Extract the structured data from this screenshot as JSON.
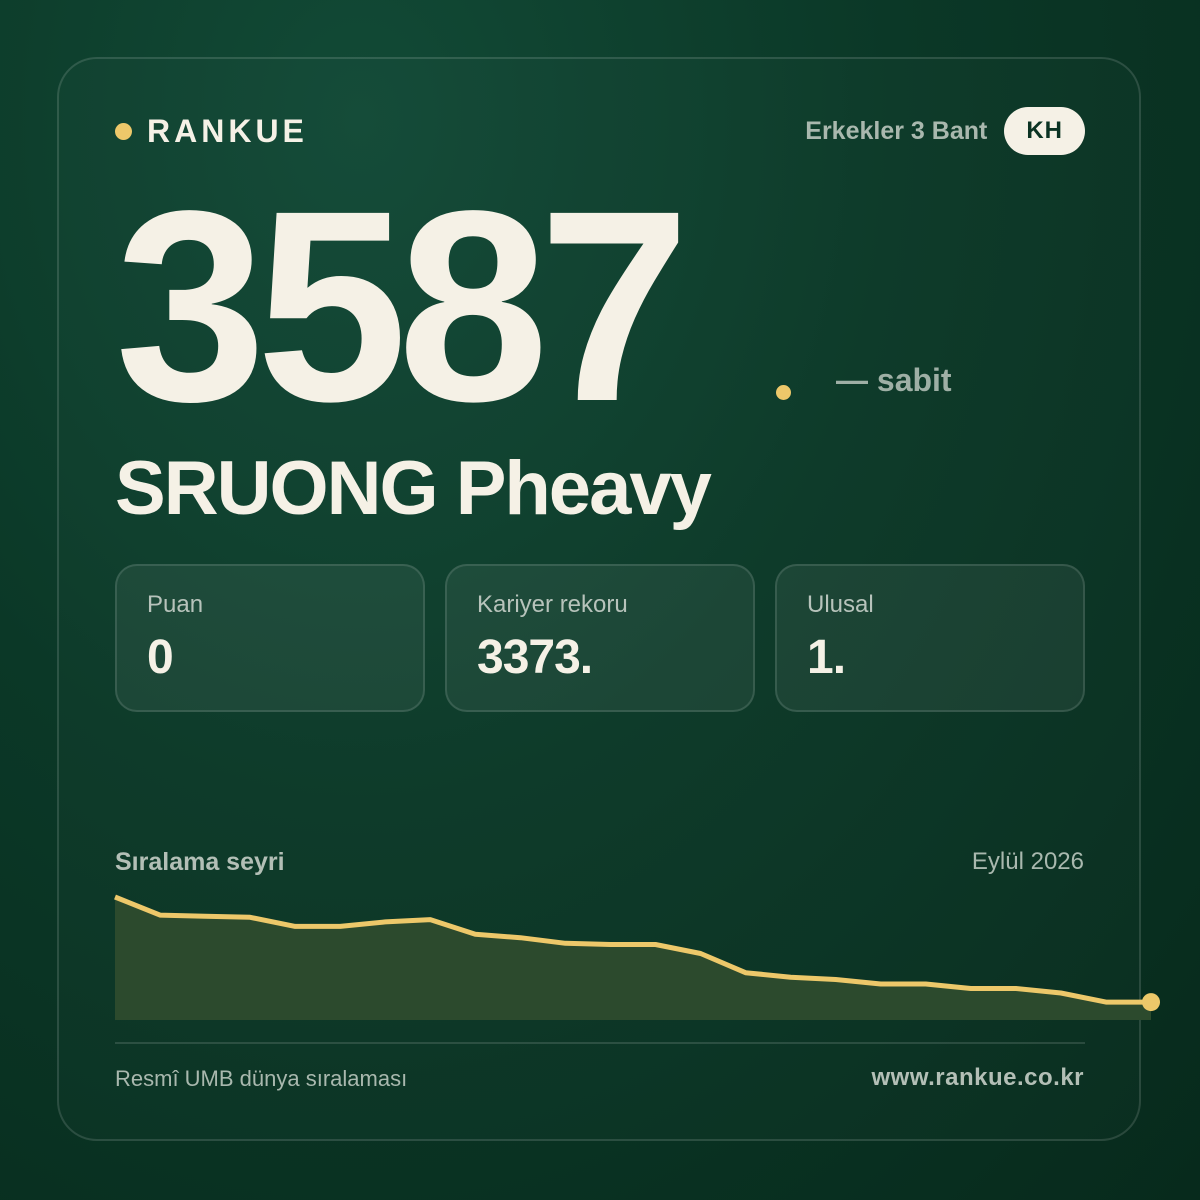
{
  "brand": {
    "name": "RANKUE",
    "dot_color": "#edc86a"
  },
  "header": {
    "category": "Erkekler 3 Bant",
    "country_code": "KH"
  },
  "rank": {
    "number": "3587",
    "trend": "— sabit"
  },
  "player": {
    "name": "SRUONG Pheavy"
  },
  "stats": [
    {
      "label": "Puan",
      "value": "0"
    },
    {
      "label": "Kariyer rekoru",
      "value": "3373."
    },
    {
      "label": "Ulusal",
      "value": "1."
    }
  ],
  "chart": {
    "title": "Sıralama seyri",
    "date": "Eylül 2026"
  },
  "chart_data": {
    "type": "area",
    "y": [
      0.0,
      0.16,
      0.17,
      0.18,
      0.26,
      0.26,
      0.22,
      0.2,
      0.33,
      0.36,
      0.41,
      0.42,
      0.42,
      0.5,
      0.67,
      0.71,
      0.73,
      0.77,
      0.77,
      0.81,
      0.81,
      0.85,
      0.93,
      0.93
    ],
    "grid": false,
    "line_color": "#edc86a",
    "fill_color": "#2c4a2d"
  },
  "footer": {
    "source": "Resmî UMB dünya sıralaması",
    "website": "www.rankue.co.kr"
  }
}
